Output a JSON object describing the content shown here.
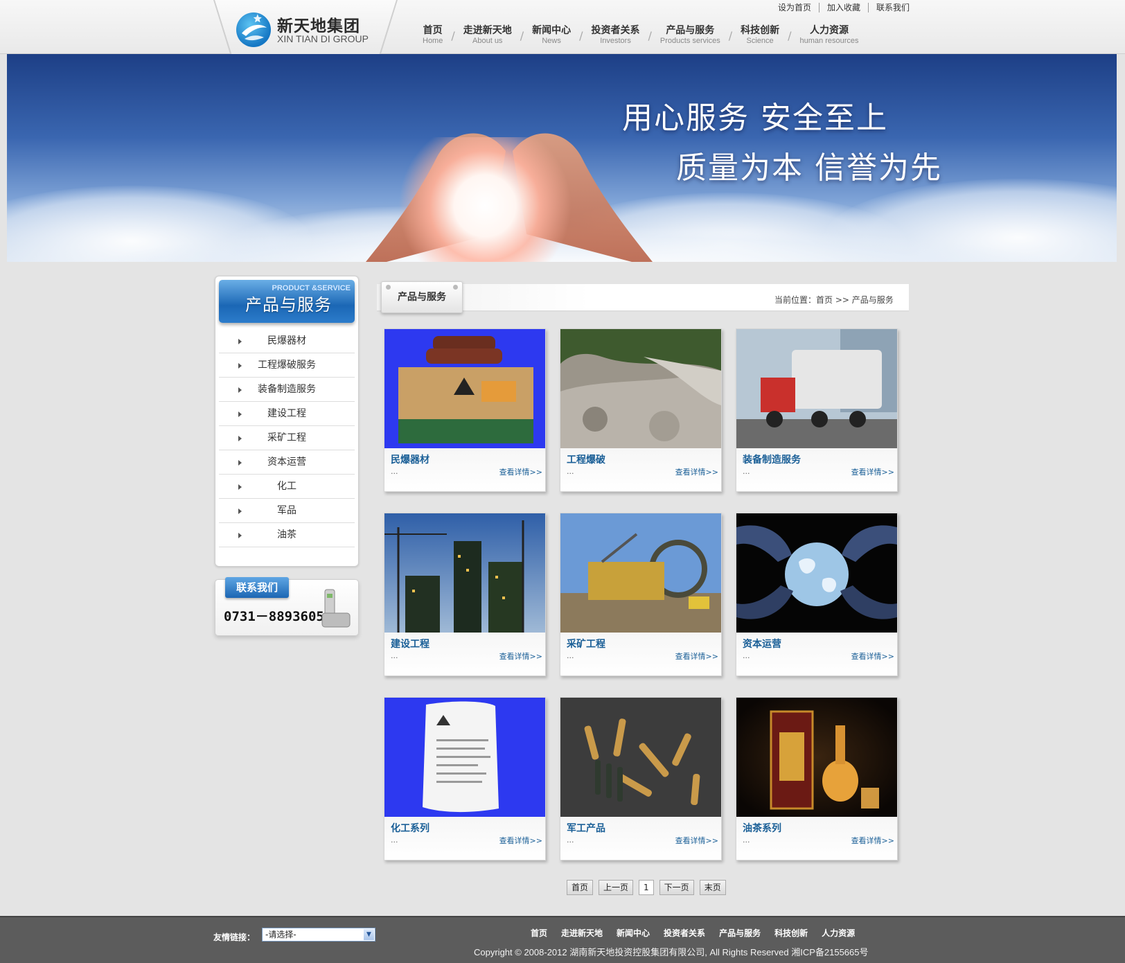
{
  "brand": {
    "name_cn": "新天地集团",
    "name_en": "XIN TIAN DI GROUP"
  },
  "toplinks": [
    "设为首页",
    "加入收藏",
    "联系我们"
  ],
  "nav": [
    {
      "cn": "首页",
      "en": "Home"
    },
    {
      "cn": "走进新天地",
      "en": "About  us"
    },
    {
      "cn": "新闻中心",
      "en": "News"
    },
    {
      "cn": "投资者关系",
      "en": "Investors"
    },
    {
      "cn": "产品与服务",
      "en": "Products services"
    },
    {
      "cn": "科技创新",
      "en": "Science"
    },
    {
      "cn": "人力资源",
      "en": "human resources"
    }
  ],
  "banner": {
    "line1": "用心服务 安全至上",
    "line2": "质量为本 信誉为先"
  },
  "sidebar": {
    "title_en": "PRODUCT &SERVICE",
    "title_cn": "产品与服务",
    "items": [
      "民爆器材",
      "工程爆破服务",
      "装备制造服务",
      "建设工程",
      "采矿工程",
      "资本运营",
      "化工",
      "军品",
      "油茶"
    ]
  },
  "contact": {
    "label": "联系我们",
    "phone": "0731－88936057"
  },
  "content": {
    "tab_title": "产品与服务",
    "crumb": "当前位置：首页 >> 产品与服务"
  },
  "cards": [
    {
      "name": "民爆器材",
      "ellipsis": "...",
      "more": "查看详情>>"
    },
    {
      "name": "工程爆破",
      "ellipsis": "...",
      "more": "查看详情>>"
    },
    {
      "name": "装备制造服务",
      "ellipsis": "...",
      "more": "查看详情>>"
    },
    {
      "name": "建设工程",
      "ellipsis": "...",
      "more": "查看详情>>"
    },
    {
      "name": "采矿工程",
      "ellipsis": "...",
      "more": "查看详情>>"
    },
    {
      "name": "资本运营",
      "ellipsis": "...",
      "more": "查看详情>>"
    },
    {
      "name": "化工系列",
      "ellipsis": "...",
      "more": "查看详情>>"
    },
    {
      "name": "军工产品",
      "ellipsis": "...",
      "more": "查看详情>>"
    },
    {
      "name": "油茶系列",
      "ellipsis": "...",
      "more": "查看详情>>"
    }
  ],
  "pager": [
    "首页",
    "上一页",
    "1",
    "下一页",
    "末页"
  ],
  "footer": {
    "friend_label": "友情链接：",
    "friend_select": "-请选择-",
    "nav": [
      "首页",
      "走进新天地",
      "新闻中心",
      "投资者关系",
      "产品与服务",
      "科技创新",
      "人力资源"
    ],
    "copyright": "Copyright © 2008-2012 湖南新天地投资控股集团有限公司, All Rights Reserved   湘ICP备2155665号"
  },
  "colors": {
    "accent_blue": "#1b67b5",
    "link_blue": "#1a5f97",
    "footer_bg": "#5c5c5c"
  }
}
